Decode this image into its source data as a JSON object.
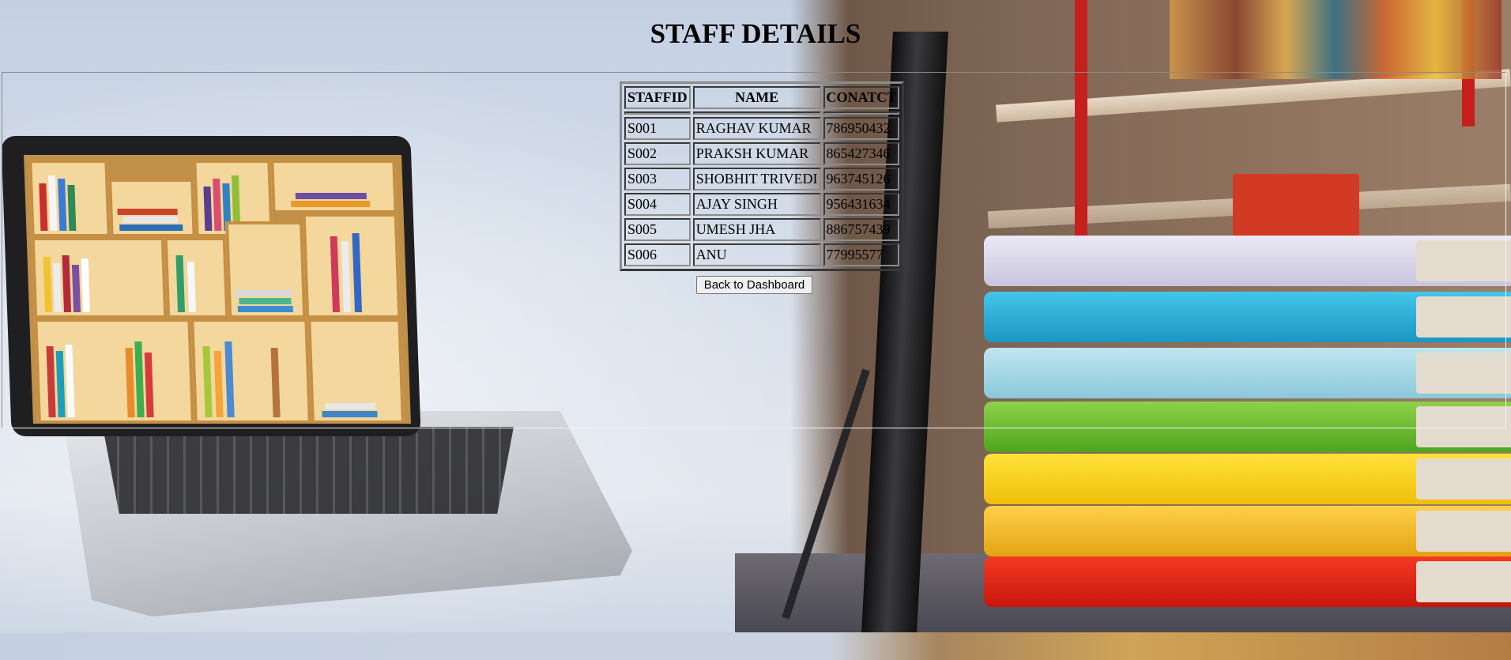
{
  "page": {
    "title": "STAFF DETAILS"
  },
  "table": {
    "headers": [
      "STAFFID",
      "NAME",
      "CONATCT"
    ],
    "rows": [
      [
        "S001",
        "RAGHAV KUMAR",
        "786950432"
      ],
      [
        "S002",
        "PRAKSH KUMAR",
        "865427346"
      ],
      [
        "S003",
        "SHOBHIT TRIVEDI",
        "963745126"
      ],
      [
        "S004",
        "AJAY SINGH",
        "956431634"
      ],
      [
        "S005",
        "UMESH JHA",
        "886757439"
      ],
      [
        "S006",
        "ANU",
        "77995577"
      ]
    ]
  },
  "actions": {
    "back_label": "Back to Dashboard"
  }
}
